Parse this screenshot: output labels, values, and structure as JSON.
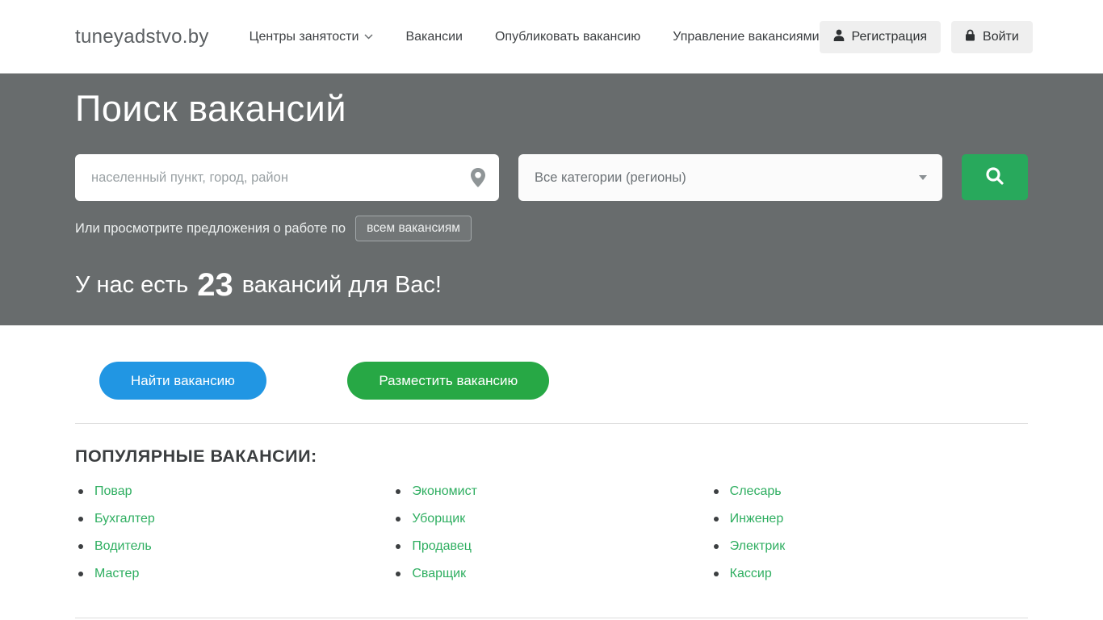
{
  "navbar": {
    "logo": "tuneyadstvo.by",
    "items": [
      {
        "label": "Центры занятости",
        "has_dropdown": true
      },
      {
        "label": "Вакансии",
        "has_dropdown": false
      },
      {
        "label": "Опубликовать вакансию",
        "has_dropdown": false
      },
      {
        "label": "Управление вакансиями",
        "has_dropdown": false
      }
    ],
    "register_label": "Регистрация",
    "login_label": "Войти"
  },
  "hero": {
    "title": "Поиск вакансий",
    "location_placeholder": "населенный пункт, город, район",
    "category_selected": "Все категории (регионы)",
    "browse_text": "Или просмотрите предложения о работе по",
    "browse_button_label": "всем вакансиям",
    "count_prefix": "У нас есть",
    "count": "23",
    "count_suffix": "вакансий для Вас!"
  },
  "actions": {
    "find_button_label": "Найти вакансию",
    "post_button_label": "Разместить вакансию"
  },
  "popular": {
    "heading": "ПОПУЛЯРНЫЕ ВАКАНСИИ:",
    "columns": [
      [
        "Повар",
        "Бухгалтер",
        "Водитель",
        "Мастер"
      ],
      [
        "Экономист",
        "Уборщик",
        "Продавец",
        "Сварщик"
      ],
      [
        "Слесарь",
        "Инженер",
        "Электрик",
        "Кассир"
      ]
    ]
  },
  "icons": {
    "register": "person-icon",
    "login": "lock-icon",
    "location": "map-pin-icon",
    "search": "magnifier-icon",
    "dropdown": "chevron-down-icon"
  },
  "colors": {
    "hero_background": "#686c6d",
    "search_button_green": "#28a95c",
    "find_button_blue": "#2196e3",
    "post_button_green": "#27a845",
    "link_green": "#2eae60",
    "nav_button_gray": "#efefef"
  }
}
